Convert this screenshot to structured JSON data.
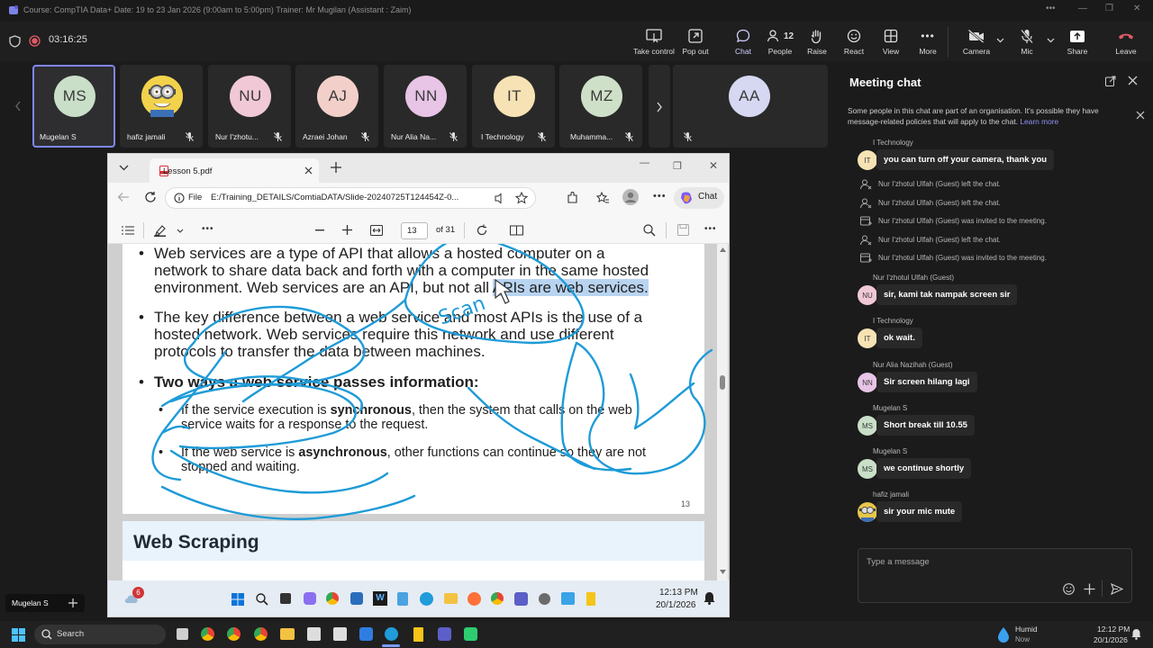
{
  "window": {
    "title": "Course: CompTIA Data+ Date: 19 to 23 Jan 2026 (9:00am to 5:00pm) Trainer: Mr Mugilan (Assistant : Zaim)"
  },
  "meeting": {
    "timer": "03:16:25",
    "toolbar": {
      "take_control": "Take control",
      "pop_out": "Pop out",
      "chat": "Chat",
      "people": "People",
      "people_count": "12",
      "raise": "Raise",
      "react": "React",
      "view": "View",
      "more": "More",
      "camera": "Camera",
      "mic": "Mic",
      "share": "Share",
      "leave": "Leave"
    },
    "participants": [
      {
        "initials": "MS",
        "name": "Mugelan S",
        "color": "#c9dfc8"
      },
      {
        "initials": "",
        "name": "hafiz jamali",
        "color": "#e7c74a"
      },
      {
        "initials": "NU",
        "name": "Nur I'zhotu...",
        "color": "#f0c8d6"
      },
      {
        "initials": "AJ",
        "name": "Azraei Johan",
        "color": "#f2d0c9"
      },
      {
        "initials": "NN",
        "name": "Nur Alia Na...",
        "color": "#e8c4e6"
      },
      {
        "initials": "IT",
        "name": "I Technology",
        "color": "#f6e2b4"
      },
      {
        "initials": "MZ",
        "name": "Muhamma...",
        "color": "#cfe0c8"
      }
    ],
    "stage_participant": {
      "initials": "AA",
      "color": "#d6d8f2"
    },
    "presenter_label": "Mugelan S"
  },
  "chat": {
    "title": "Meeting chat",
    "banner_text": "Some people in this chat are part of an organisation. It's possible they have message-related policies that will apply to the chat.",
    "banner_link": "Learn more",
    "items": [
      {
        "kind": "msg",
        "sender": "I Technology",
        "initials": "IT",
        "color": "#f6e2b4",
        "text": "you can turn off your camera, thank you"
      },
      {
        "kind": "sys",
        "text": "Nur I'zhotul Ulfah (Guest) left the chat."
      },
      {
        "kind": "sys",
        "text": "Nur I'zhotul Ulfah (Guest) left the chat."
      },
      {
        "kind": "sys",
        "text": "Nur I'zhotul Ulfah (Guest) was invited to the meeting."
      },
      {
        "kind": "sys",
        "text": "Nur I'zhotul Ulfah (Guest) left the chat."
      },
      {
        "kind": "sys",
        "text": "Nur I'zhotul Ulfah (Guest) was invited to the meeting."
      },
      {
        "kind": "msg",
        "sender": "Nur I'zhotul Ulfah (Guest)",
        "initials": "NU",
        "color": "#f0c8d6",
        "text": "sir, kami tak nampak screen sir"
      },
      {
        "kind": "msg",
        "sender": "I Technology",
        "initials": "IT",
        "color": "#f6e2b4",
        "text": "ok wait."
      },
      {
        "kind": "msg",
        "sender": "Nur Alia Nazihah (Guest)",
        "initials": "NN",
        "color": "#e8c4e6",
        "text": "Sir screen hilang lagi"
      },
      {
        "kind": "msg",
        "sender": "Mugelan S",
        "initials": "MS",
        "color": "#c9dfc8",
        "text": "Short break till 10.55"
      },
      {
        "kind": "msg",
        "sender": "Mugelan S",
        "initials": "MS",
        "color": "#c9dfc8",
        "text": "we continue shortly"
      },
      {
        "kind": "msg",
        "sender": "hafiz jamali",
        "initials": "",
        "color": "#e7c74a",
        "text": "sir your mic mute"
      }
    ],
    "composer_placeholder": "Type a message"
  },
  "browser": {
    "tab_title": "Lesson 5.pdf",
    "url_label": "File",
    "url": "E:/Training_DETAILS/ComtiaDATA/Slide-20240725T124454Z-0...",
    "chat_label": "Chat",
    "page_current": "13",
    "page_total": "of 31"
  },
  "slide": {
    "bullet1_lines": [
      "Web services are a type of API that allows a hosted computer on a",
      "network to share data back and forth with a computer in the same hosted",
      "environment. Web services are an API, but not all "
    ],
    "bullet1_highlight": "APIs are web services.",
    "bullet2_lines": [
      "The key difference between a web service and most APIs is the use of a",
      "hosted network. Web services require this network and use different",
      "protocols to transfer the data between machines."
    ],
    "bullet3": "Two ways a web service passes information:",
    "sub1_pre": "If the service execution is ",
    "sub1_bold": "synchronous",
    "sub1_post": ", then the system that calls on the web",
    "sub1_line2": "service waits for a response to the request.",
    "sub2_pre": "If the web service is ",
    "sub2_bold": "asynchronous",
    "sub2_post": ", other functions can continue so they are not",
    "sub2_line2": "stopped and waiting.",
    "page_number": "13",
    "next_title": "Web Scraping",
    "annotation_text": "Scan"
  },
  "remote_taskbar": {
    "badge": "6",
    "time": "12:13 PM",
    "date": "20/1/2026"
  },
  "host_taskbar": {
    "search": "Search",
    "weather": "Humid",
    "weather_sub": "Now",
    "time": "12:12 PM",
    "date": "20/1/2026"
  }
}
